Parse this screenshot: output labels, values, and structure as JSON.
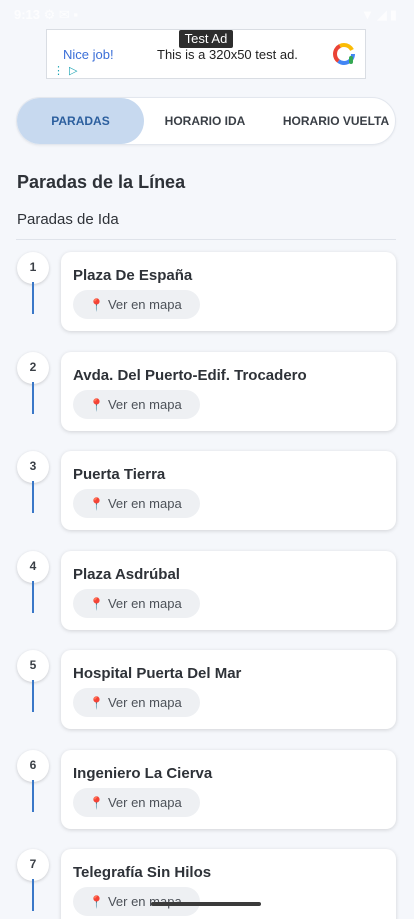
{
  "status_bar": {
    "time": "9:13 ⚙ ✉ ▪",
    "right_icons": "▼◢▮"
  },
  "ad": {
    "label": "Test Ad",
    "nice": "Nice job!",
    "text": "This is a 320x50 test ad.",
    "info": "⋮ ▷",
    "logo_icon": "ad-logo-icon"
  },
  "tabs": [
    {
      "label": "PARADAS",
      "active": true
    },
    {
      "label": "HORARIO IDA",
      "active": false
    },
    {
      "label": "HORARIO VUELTA",
      "active": false
    }
  ],
  "section_title": "Paradas de la Línea",
  "subsection_title": "Paradas de Ida",
  "map_button_label": "Ver en mapa",
  "map_button_icon": "📍",
  "stops": [
    {
      "number": "1",
      "name": "Plaza De España"
    },
    {
      "number": "2",
      "name": "Avda. Del Puerto-Edif. Trocadero"
    },
    {
      "number": "3",
      "name": "Puerta Tierra"
    },
    {
      "number": "4",
      "name": "Plaza Asdrúbal"
    },
    {
      "number": "5",
      "name": "Hospital Puerta Del Mar"
    },
    {
      "number": "6",
      "name": "Ingeniero La Cierva"
    },
    {
      "number": "7",
      "name": "Telegrafía Sin Hilos"
    }
  ],
  "colors": {
    "accent": "#3a78c8",
    "active_tab": "#c7d9ef",
    "pin": "#e53935"
  }
}
